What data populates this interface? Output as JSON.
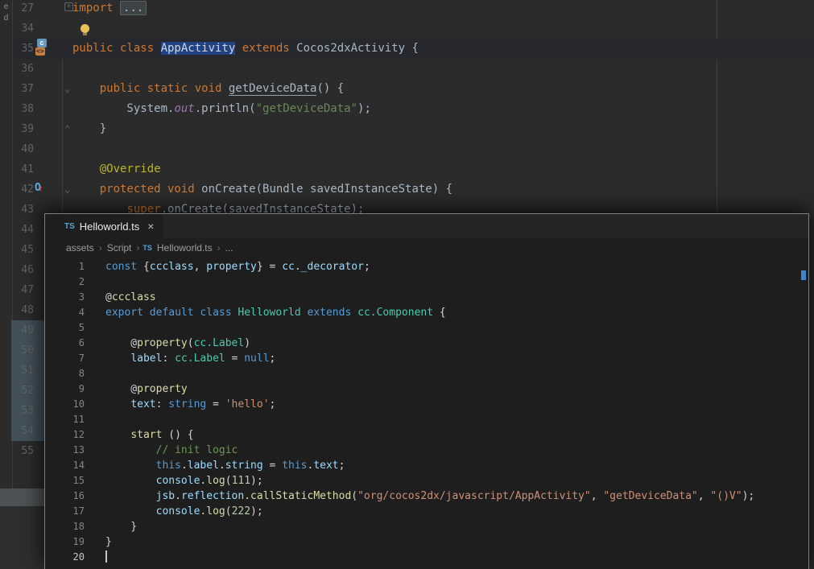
{
  "icons": {
    "close": "×",
    "breadcrumb_separator": "›",
    "fold_collapsed": "+",
    "fold_arrow_down": "⌄",
    "fold_arrow_up": "⌃",
    "override_letter": "O",
    "override_arrow": "↑",
    "ts_badge": "TS",
    "code_tag": "<>",
    "class_letter": "c",
    "lightbulb": "intention-bulb"
  },
  "background_ide": {
    "left_edge": [
      "e",
      "d"
    ],
    "rows": [
      {
        "n": "27",
        "tokens": [
          [
            "import ",
            "j-kw"
          ],
          [
            "...",
            "j-foldbox"
          ]
        ]
      },
      {
        "n": "34",
        "tokens": []
      },
      {
        "n": "35",
        "cls": "hl",
        "tokens": [
          [
            "public class ",
            "j-kw"
          ],
          [
            "AppActivity",
            "j-def j-sel"
          ],
          [
            " ",
            "j-def"
          ],
          [
            "extends",
            "j-kw"
          ],
          [
            " Cocos2dxActivity {",
            "j-def"
          ]
        ]
      },
      {
        "n": "36",
        "tokens": []
      },
      {
        "n": "37",
        "tokens": [
          [
            "    ",
            "j-def"
          ],
          [
            "public static void ",
            "j-kw"
          ],
          [
            "getDeviceData",
            "j-def j-ul"
          ],
          [
            "() {",
            "j-def"
          ]
        ]
      },
      {
        "n": "38",
        "tokens": [
          [
            "        System.",
            "j-def"
          ],
          [
            "out",
            "j-field"
          ],
          [
            ".println(",
            "j-def"
          ],
          [
            "\"getDeviceData\"",
            "j-str"
          ],
          [
            ");",
            "j-def"
          ]
        ]
      },
      {
        "n": "39",
        "tokens": [
          [
            "    }",
            "j-def"
          ]
        ]
      },
      {
        "n": "40",
        "tokens": []
      },
      {
        "n": "41",
        "tokens": [
          [
            "    ",
            "j-def"
          ],
          [
            "@Override",
            "j-ann"
          ]
        ]
      },
      {
        "n": "42",
        "tokens": [
          [
            "    ",
            "j-def"
          ],
          [
            "protected void ",
            "j-kw"
          ],
          [
            "onCreate",
            "j-def"
          ],
          [
            "(Bundle savedInstanceState) {",
            "j-def"
          ]
        ]
      },
      {
        "n": "43",
        "tokens": [
          [
            "        ",
            "j-def"
          ],
          [
            "super",
            "j-kw"
          ],
          [
            ".onCreate(savedInstanceState);",
            "j-def"
          ]
        ]
      },
      {
        "n": "44",
        "tokens": []
      },
      {
        "n": "45",
        "tokens": []
      },
      {
        "n": "46",
        "tokens": []
      },
      {
        "n": "47",
        "tokens": []
      },
      {
        "n": "48",
        "tokens": []
      },
      {
        "n": "49",
        "tokens": []
      },
      {
        "n": "50",
        "tokens": []
      },
      {
        "n": "51",
        "tokens": []
      },
      {
        "n": "52",
        "tokens": []
      },
      {
        "n": "53",
        "tokens": []
      },
      {
        "n": "54",
        "tokens": []
      },
      {
        "n": "55",
        "tokens": []
      }
    ]
  },
  "overlay_editor": {
    "tab": {
      "icon": "TS",
      "title": "Helloworld.ts",
      "close": "×"
    },
    "breadcrumb": {
      "items": [
        "assets",
        "Script",
        "Helloworld.ts",
        "..."
      ],
      "separator": "›",
      "file_icon": "TS"
    },
    "lines": [
      {
        "n": "1",
        "tokens": [
          [
            "const ",
            "t-kw"
          ],
          [
            "{",
            "t-def"
          ],
          [
            "ccclass",
            "t-var"
          ],
          [
            ", ",
            "t-def"
          ],
          [
            "property",
            "t-var"
          ],
          [
            "} = ",
            "t-def"
          ],
          [
            "cc",
            "t-var"
          ],
          [
            ".",
            "t-def"
          ],
          [
            "_decorator",
            "t-var"
          ],
          [
            ";",
            "t-def"
          ]
        ]
      },
      {
        "n": "2",
        "tokens": []
      },
      {
        "n": "3",
        "tokens": [
          [
            "@",
            "t-def"
          ],
          [
            "ccclass",
            "t-fn"
          ]
        ]
      },
      {
        "n": "4",
        "tokens": [
          [
            "export ",
            "t-kw"
          ],
          [
            "default ",
            "t-kw"
          ],
          [
            "class ",
            "t-kw"
          ],
          [
            "Helloworld",
            "t-cls"
          ],
          [
            " ",
            "t-def"
          ],
          [
            "extends",
            "t-kw"
          ],
          [
            " ",
            "t-def"
          ],
          [
            "cc.Component",
            "t-cls"
          ],
          [
            " {",
            "t-def"
          ]
        ]
      },
      {
        "n": "5",
        "tokens": []
      },
      {
        "n": "6",
        "tokens": [
          [
            "    @",
            "t-def"
          ],
          [
            "property",
            "t-fn"
          ],
          [
            "(",
            "t-def"
          ],
          [
            "cc.Label",
            "t-cls"
          ],
          [
            ")",
            "t-def"
          ]
        ]
      },
      {
        "n": "7",
        "tokens": [
          [
            "    ",
            "t-def"
          ],
          [
            "label",
            "t-var"
          ],
          [
            ": ",
            "t-def"
          ],
          [
            "cc.Label",
            "t-cls"
          ],
          [
            " = ",
            "t-def"
          ],
          [
            "null",
            "t-kw"
          ],
          [
            ";",
            "t-def"
          ]
        ]
      },
      {
        "n": "8",
        "tokens": []
      },
      {
        "n": "9",
        "tokens": [
          [
            "    @",
            "t-def"
          ],
          [
            "property",
            "t-fn"
          ]
        ]
      },
      {
        "n": "10",
        "tokens": [
          [
            "    ",
            "t-def"
          ],
          [
            "text",
            "t-var"
          ],
          [
            ": ",
            "t-def"
          ],
          [
            "string",
            "t-kw"
          ],
          [
            " = ",
            "t-def"
          ],
          [
            "'hello'",
            "t-str"
          ],
          [
            ";",
            "t-def"
          ]
        ]
      },
      {
        "n": "11",
        "tokens": []
      },
      {
        "n": "12",
        "tokens": [
          [
            "    ",
            "t-def"
          ],
          [
            "start",
            "t-fn"
          ],
          [
            " () {",
            "t-def"
          ]
        ]
      },
      {
        "n": "13",
        "tokens": [
          [
            "        ",
            "t-def"
          ],
          [
            "// init logic",
            "t-cmt"
          ]
        ]
      },
      {
        "n": "14",
        "tokens": [
          [
            "        ",
            "t-def"
          ],
          [
            "this",
            "t-kw"
          ],
          [
            ".",
            "t-def"
          ],
          [
            "label",
            "t-var"
          ],
          [
            ".",
            "t-def"
          ],
          [
            "string",
            "t-var"
          ],
          [
            " = ",
            "t-def"
          ],
          [
            "this",
            "t-kw"
          ],
          [
            ".",
            "t-def"
          ],
          [
            "text",
            "t-var"
          ],
          [
            ";",
            "t-def"
          ]
        ]
      },
      {
        "n": "15",
        "tokens": [
          [
            "        ",
            "t-def"
          ],
          [
            "console",
            "t-var"
          ],
          [
            ".",
            "t-def"
          ],
          [
            "log",
            "t-fn"
          ],
          [
            "(",
            "t-def"
          ],
          [
            "111",
            "t-num"
          ],
          [
            ");",
            "t-def"
          ]
        ]
      },
      {
        "n": "16",
        "tokens": [
          [
            "        ",
            "t-def"
          ],
          [
            "jsb",
            "t-var"
          ],
          [
            ".",
            "t-def"
          ],
          [
            "reflection",
            "t-var"
          ],
          [
            ".",
            "t-def"
          ],
          [
            "callStaticMethod",
            "t-fn"
          ],
          [
            "(",
            "t-def"
          ],
          [
            "\"org/cocos2dx/javascript/AppActivity\"",
            "t-str"
          ],
          [
            ", ",
            "t-def"
          ],
          [
            "\"getDeviceData\"",
            "t-str"
          ],
          [
            ", ",
            "t-def"
          ],
          [
            "\"()V\"",
            "t-str"
          ],
          [
            ");",
            "t-def"
          ]
        ]
      },
      {
        "n": "17",
        "tokens": [
          [
            "        ",
            "t-def"
          ],
          [
            "console",
            "t-var"
          ],
          [
            ".",
            "t-def"
          ],
          [
            "log",
            "t-fn"
          ],
          [
            "(",
            "t-def"
          ],
          [
            "222",
            "t-num"
          ],
          [
            ");",
            "t-def"
          ]
        ]
      },
      {
        "n": "18",
        "tokens": [
          [
            "    }",
            "t-def"
          ]
        ]
      },
      {
        "n": "19",
        "tokens": [
          [
            "}",
            "t-def"
          ]
        ]
      },
      {
        "n": "20",
        "cls": "cur",
        "cursor": true,
        "tokens": []
      }
    ]
  }
}
